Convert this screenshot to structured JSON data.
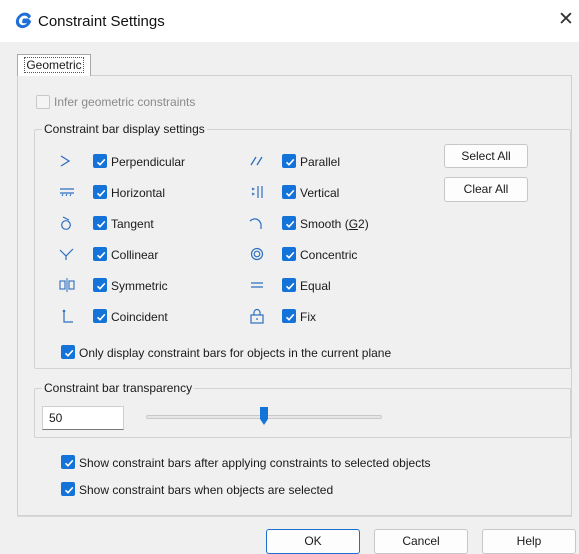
{
  "window": {
    "title": "Constraint Settings",
    "close_glyph": "✕"
  },
  "tabs": [
    {
      "label": "Geometric",
      "active": true
    }
  ],
  "infer": {
    "label": "Infer geometric constraints",
    "checked": false,
    "enabled": false
  },
  "display_group": {
    "legend": "Constraint bar display settings",
    "items": [
      {
        "label": "Perpendicular",
        "icon": "perpendicular-icon",
        "checked": true
      },
      {
        "label": "Parallel",
        "icon": "parallel-icon",
        "checked": true
      },
      {
        "label": "Horizontal",
        "icon": "horizontal-icon",
        "checked": true
      },
      {
        "label": "Vertical",
        "icon": "vertical-icon",
        "checked": true
      },
      {
        "label": "Tangent",
        "icon": "tangent-icon",
        "checked": true
      },
      {
        "label": "Smooth (",
        "mnemonic": "G",
        "label_tail": "2)",
        "icon": "smooth-icon",
        "checked": true
      },
      {
        "label": "Collinear",
        "icon": "collinear-icon",
        "checked": true
      },
      {
        "label": "Concentric",
        "icon": "concentric-icon",
        "checked": true
      },
      {
        "label": "Symmetric",
        "icon": "symmetric-icon",
        "checked": true
      },
      {
        "label": "Equal",
        "icon": "equal-icon",
        "checked": true
      },
      {
        "label": "Coincident",
        "icon": "coincident-icon",
        "checked": true
      },
      {
        "label": "Fix",
        "icon": "fix-icon",
        "checked": true
      }
    ],
    "select_all_label": "Select All",
    "clear_all_label": "Clear All",
    "current_plane": {
      "label": "Only display constraint bars for objects in the current plane",
      "checked": true
    }
  },
  "transparency_group": {
    "legend": "Constraint bar transparency",
    "value": "50",
    "slider_fraction": 0.5
  },
  "options": [
    {
      "label": "Show constraint bars after applying constraints to selected objects",
      "checked": true
    },
    {
      "label": "Show constraint bars when objects are selected",
      "checked": true
    }
  ],
  "footer": {
    "ok_label": "OK",
    "cancel_label": "Cancel",
    "help_label": "Help"
  },
  "colors": {
    "accent": "#1473d9",
    "app_icon": "#1f6fd6",
    "dialog_bg": "#f0f0f0"
  }
}
